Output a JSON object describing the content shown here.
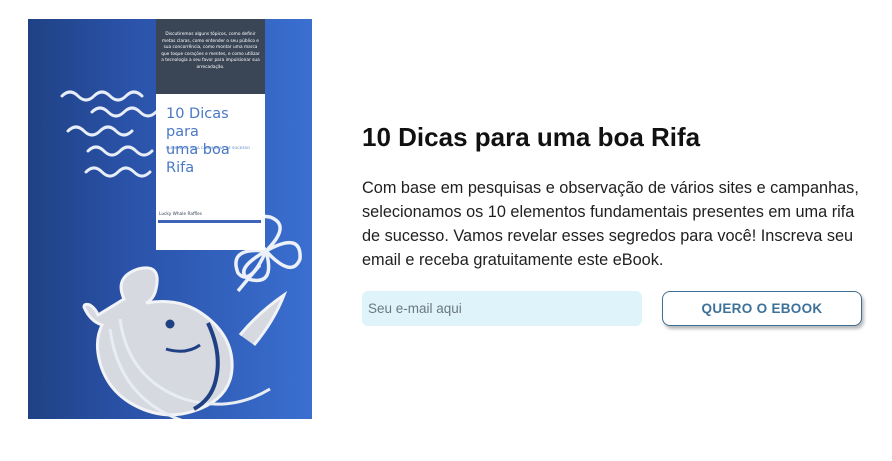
{
  "ebook_cover": {
    "intro_text": "Discutiremos alguns tópicos, como definir metas claras, como entender o seu público e sua concorrência, como montar uma marca que toque corações e mentes, e como utilizar a tecnologia a seu favor para impulsionar sua arrecadação.",
    "title_line1": "10 Dicas para",
    "title_line2": "uma boa Rifa",
    "subtitle": "ELEMENTOS PARA CAMPANHAS DE SUCESSO",
    "author": "Lucky Whale Raffles",
    "colors": {
      "gradient_dark": "#1f4184",
      "gradient_light": "#3a6fd0",
      "panel_dark": "#3a4655",
      "title": "#4a78c4"
    },
    "icons": [
      "wave-icon",
      "whale-icon",
      "clover-icon"
    ]
  },
  "content": {
    "headline": "10 Dicas para uma boa Rifa",
    "description": "Com base em pesquisas e observação de vários sites e campanhas, selecionamos os 10 elementos fundamentais presentes em uma rifa de sucesso. Vamos revelar esses segredos para você! Inscreva seu email e receba gratuitamente este eBook."
  },
  "form": {
    "email_placeholder": "Seu e-mail aqui",
    "email_value": "",
    "submit_label": "QUERO O EBOOK"
  },
  "theme": {
    "input_bg": "#dff3fb",
    "button_border": "#3f6f94",
    "button_text": "#3d7199"
  }
}
